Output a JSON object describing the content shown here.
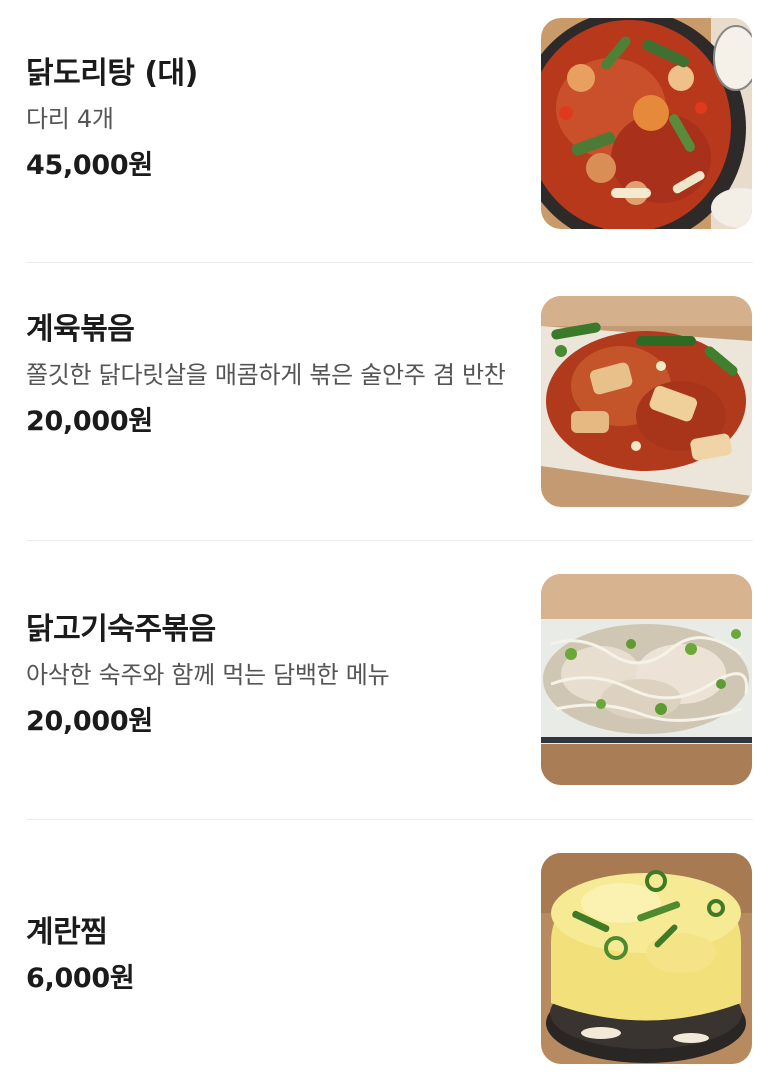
{
  "menu": {
    "items": [
      {
        "name": "닭도리탕 (대)",
        "description": "다리 4개",
        "price": "45,000원",
        "photo_icon": "braised-spicy-chicken-photo"
      },
      {
        "name": "계육볶음",
        "description": "쫄깃한 닭다릿살을 매콤하게 볶은 술안주 겸 반찬",
        "price": "20,000원",
        "photo_icon": "stir-fried-chicken-photo"
      },
      {
        "name": "닭고기숙주볶음",
        "description": "아삭한 숙주와 함께 먹는 담백한 메뉴",
        "price": "20,000원",
        "photo_icon": "chicken-bean-sprout-photo"
      },
      {
        "name": "계란찜",
        "description": "",
        "price": "6,000원",
        "photo_icon": "steamed-egg-photo"
      }
    ]
  }
}
